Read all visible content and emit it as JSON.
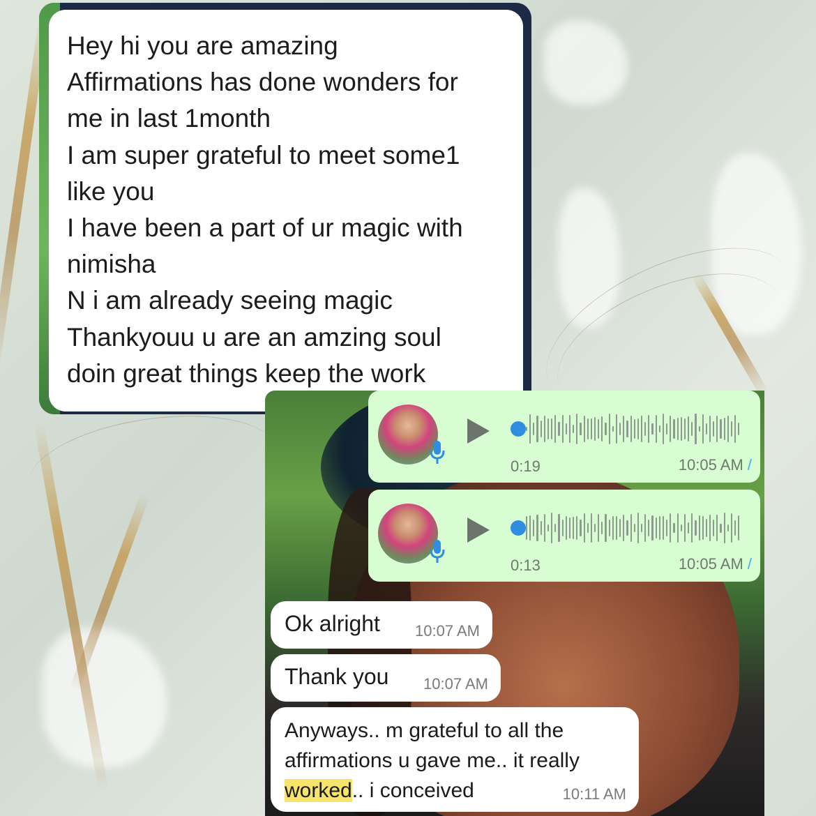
{
  "top_message": {
    "lines": [
      "Hey hi you are amazing",
      "Affirmations has done wonders for",
      "me in last 1month",
      "I am super grateful to meet some1",
      "like you",
      "I have been a part of ur magic with",
      "nimisha",
      "N i am already seeing magic",
      "Thankyouu u are an amzing soul",
      "doin great things keep the work"
    ]
  },
  "voice_notes": [
    {
      "duration": "0:19",
      "time": "10:05 AM"
    },
    {
      "duration": "0:13",
      "time": "10:05 AM"
    }
  ],
  "messages": [
    {
      "text": "Ok alright",
      "time": "10:07 AM"
    },
    {
      "text": "Thank you",
      "time": "10:07 AM"
    },
    {
      "line1": "Anyways.. m grateful to all the",
      "line2": "affirmations u gave me.. it really",
      "line3_highlight": "worked",
      "line3_rest": ".. i conceived",
      "time": "10:11 AM"
    }
  ],
  "icons": {
    "play": "play-icon",
    "mic": "mic-icon",
    "read_receipt": "double-check-icon"
  },
  "colors": {
    "voice_bubble": "#d9fdd3",
    "incoming_bubble": "#ffffff",
    "highlight": "#f6e36c",
    "mic_blue": "#2f8ee0",
    "tick_blue": "#4fb6ec"
  }
}
